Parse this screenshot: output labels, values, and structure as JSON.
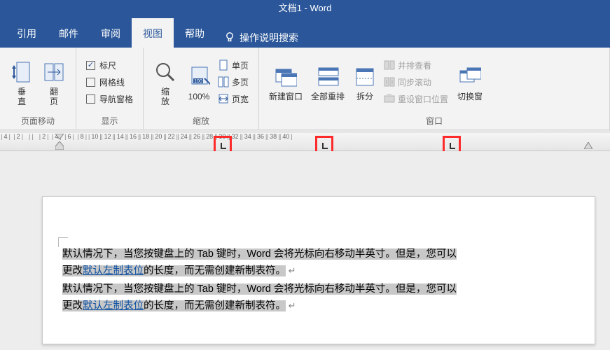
{
  "title": "文档1 - Word",
  "tabs": {
    "cite": "引用",
    "mail": "邮件",
    "review": "审阅",
    "view": "视图",
    "help": "帮助"
  },
  "tell_me": "操作说明搜索",
  "ribbon": {
    "page_move": {
      "label": "页面移动",
      "vertical": "垂\n直",
      "flip": "翻\n页"
    },
    "show": {
      "label": "显示",
      "ruler": "标尺",
      "gridlines": "网格线",
      "navpane": "导航窗格",
      "ruler_checked": true,
      "gridlines_checked": false,
      "navpane_checked": false
    },
    "zoom": {
      "label": "缩放",
      "zoom_btn": "缩\n放",
      "pct": "100%",
      "one_page": "单页",
      "multi_page": "多页",
      "page_width": "页宽"
    },
    "window": {
      "label": "窗口",
      "new_window": "新建窗口",
      "arrange_all": "全部重排",
      "split": "拆分",
      "side_by_side": "并排查看",
      "sync_scroll": "同步滚动",
      "reset_pos": "重设窗口位置",
      "switch": "切换窗"
    }
  },
  "ruler_ticks": [
    "4",
    "2",
    "",
    "2",
    "4",
    "6",
    "8",
    "10",
    "12",
    "14",
    "16",
    "18",
    "20",
    "22",
    "24",
    "26",
    "28",
    "30",
    "32",
    "34",
    "36",
    "38",
    "40"
  ],
  "doc": {
    "p1_a": "默认情况下，当您按键盘上的 Tab 键时，Word 会将光标向右移动半英寸。但是，您可以",
    "p1_b_pre": "更改",
    "p1_link": "默认左制表位",
    "p1_b_post": "的长度，而无需创建新制表符。",
    "p2_a": "默认情况下，当您按键盘上的 Tab 键时，Word 会将光标向右移动半英寸。但是，您可以",
    "p2_b_pre": "更改",
    "p2_link": "默认左制表位",
    "p2_b_post": "的长度，而无需创建新制表符。"
  }
}
